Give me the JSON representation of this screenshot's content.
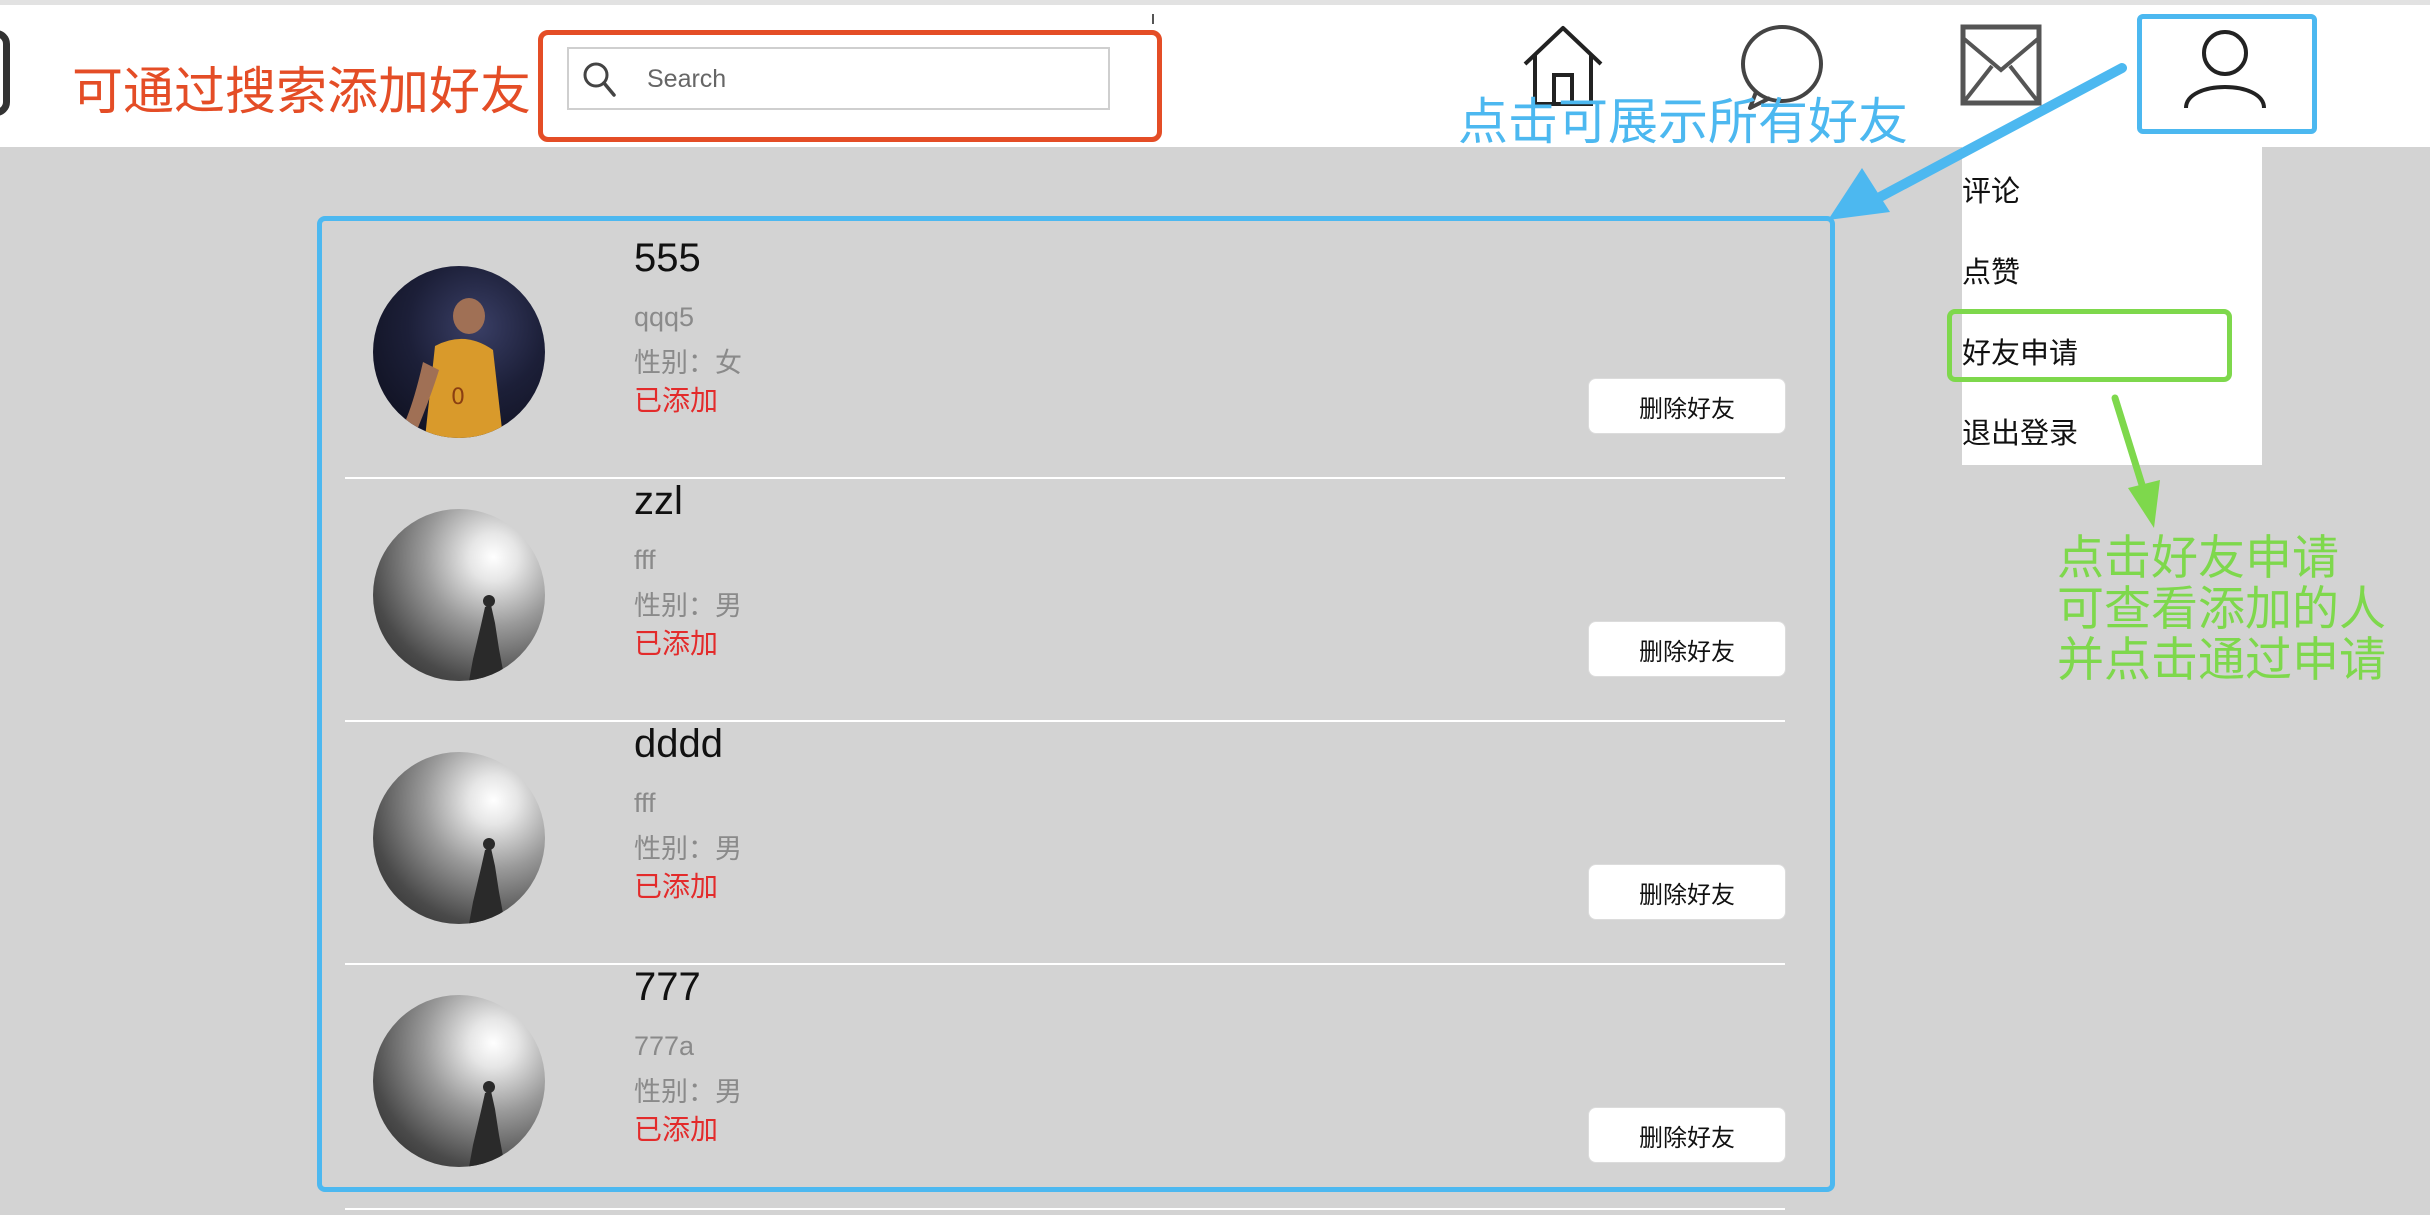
{
  "header": {
    "search": {
      "placeholder": "Search"
    },
    "nav_icons": [
      "home-icon",
      "chat-bubble-icon",
      "mail-icon",
      "user-icon"
    ]
  },
  "dropdown": {
    "items": [
      {
        "label": "评论"
      },
      {
        "label": "点赞"
      },
      {
        "label": "好友申请"
      },
      {
        "label": "退出登录"
      }
    ]
  },
  "friends": [
    {
      "name": "555",
      "account": "qqq5",
      "gender": "性别：女",
      "status": "已添加",
      "action": "删除好友",
      "avatar": "dark-photo"
    },
    {
      "name": "zzl",
      "account": "fff",
      "gender": "性别：男",
      "status": "已添加",
      "action": "删除好友",
      "avatar": "spotlight-photo"
    },
    {
      "name": "dddd",
      "account": "fff",
      "gender": "性别：男",
      "status": "已添加",
      "action": "删除好友",
      "avatar": "spotlight-photo"
    },
    {
      "name": "777",
      "account": "777a",
      "gender": "性别：男",
      "status": "已添加",
      "action": "删除好友",
      "avatar": "spotlight-photo"
    }
  ],
  "annotations": {
    "search_note": "可通过搜索添加好友",
    "friends_note": "点击可展示所有好友",
    "request_note_lines": [
      "点击好友申请",
      "可查看添加的人",
      "并点击通过申请"
    ]
  },
  "colors": {
    "annotation_orange": "#e44d26",
    "annotation_blue": "#4cb8f0",
    "annotation_green": "#7ed84c",
    "status_red": "#e32b2b",
    "list_background": "#d3d3d3"
  }
}
